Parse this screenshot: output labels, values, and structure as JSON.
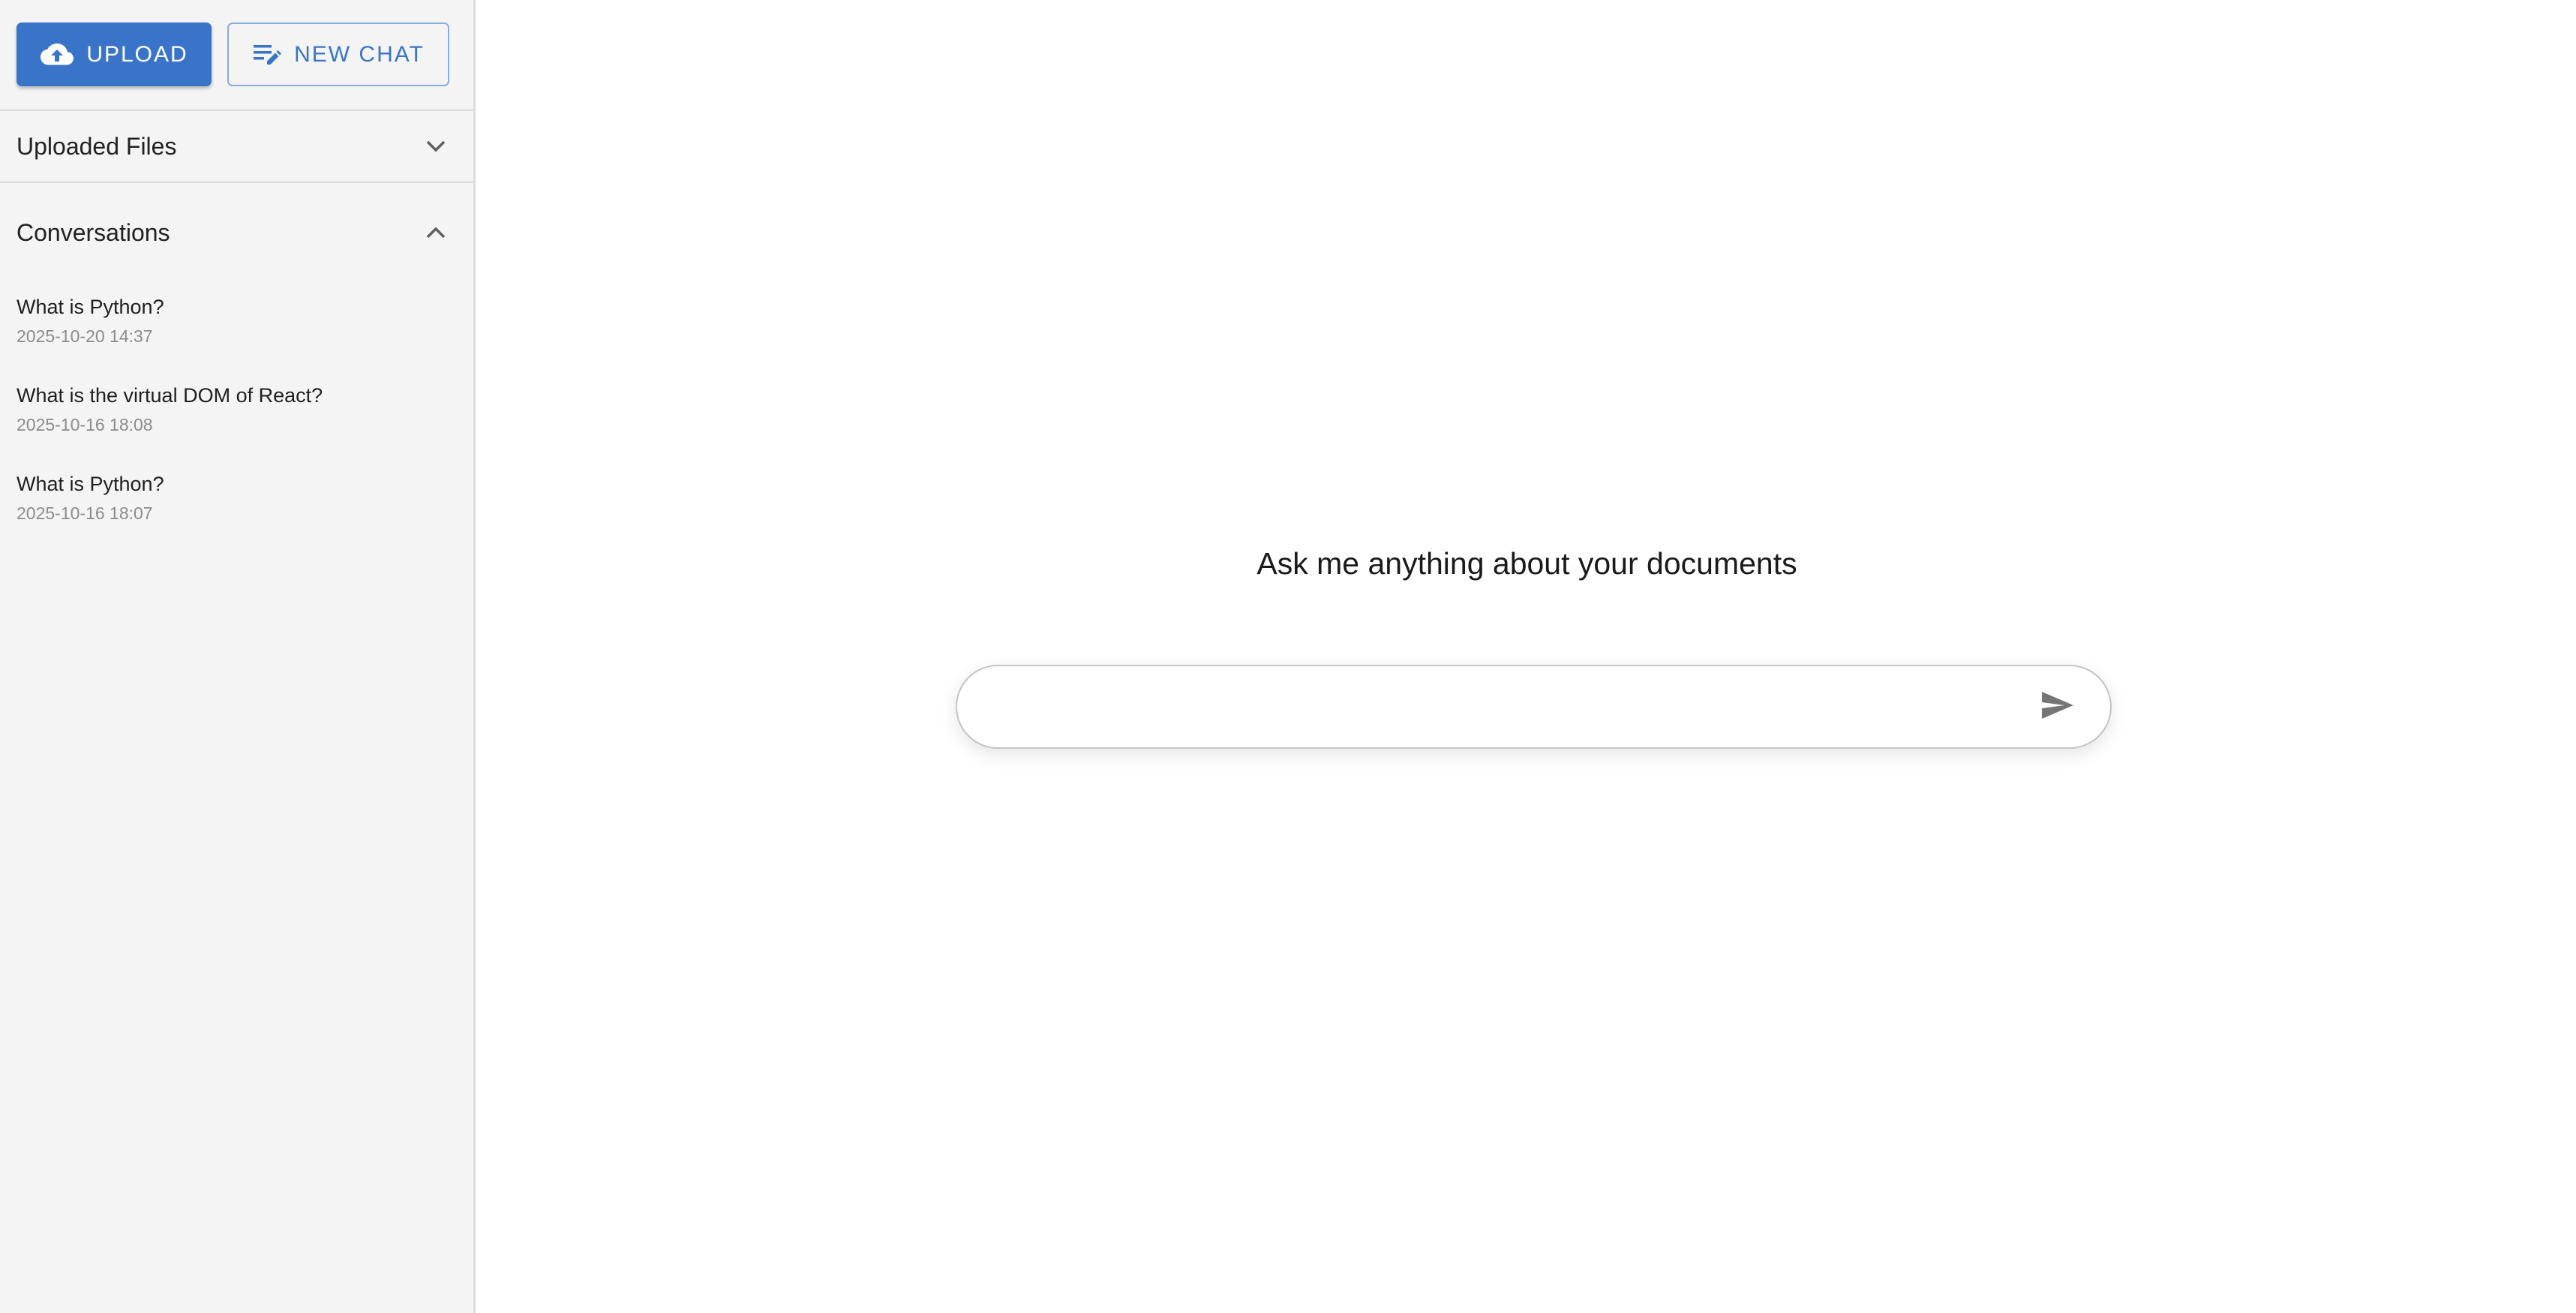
{
  "sidebar": {
    "toolbar": {
      "upload_label": "Upload",
      "new_chat_label": "New Chat"
    },
    "uploaded_files": {
      "title": "Uploaded Files",
      "expanded": false
    },
    "conversations": {
      "title": "Conversations",
      "expanded": true,
      "items": [
        {
          "title": "What is Python?",
          "time": "2025-10-20 14:37"
        },
        {
          "title": "What is the virtual DOM of React?",
          "time": "2025-10-16 18:08"
        },
        {
          "title": "What is Python?",
          "time": "2025-10-16 18:07"
        }
      ]
    }
  },
  "main": {
    "prompt": "Ask me anything about your documents",
    "input": {
      "value": "",
      "placeholder": ""
    }
  },
  "icons": {
    "upload": "cloud-upload-icon",
    "new_chat": "edit-note-icon",
    "files_toggle": "chevron-down-icon",
    "conversations_toggle": "chevron-up-icon",
    "send": "send-icon"
  },
  "colors": {
    "primary": "#3a74c9",
    "sidebar_bg": "#f4f4f4",
    "muted_text": "#8c8c8c"
  }
}
